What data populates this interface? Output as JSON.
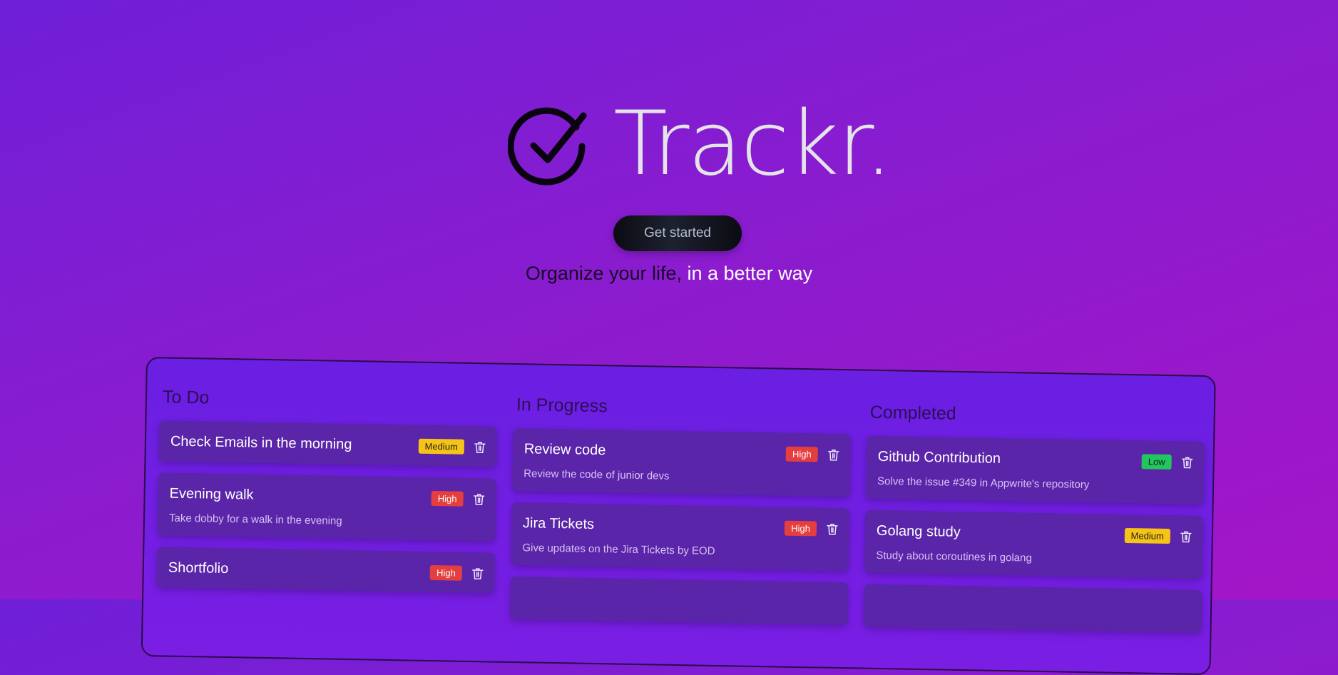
{
  "hero": {
    "brand_name": "Trackr.",
    "cta_label": "Get started",
    "tagline_dark": "Organize your life, ",
    "tagline_light": "in a better way"
  },
  "board": {
    "columns": [
      {
        "title": "To Do",
        "cards": [
          {
            "title": "Check Emails in the morning",
            "priority": "Medium",
            "description": ""
          },
          {
            "title": "Evening walk",
            "priority": "High",
            "description": "Take dobby for a walk in the evening"
          },
          {
            "title": "Shortfolio",
            "priority": "High",
            "description": ""
          }
        ]
      },
      {
        "title": "In Progress",
        "cards": [
          {
            "title": "Review code",
            "priority": "High",
            "description": "Review the code of junior devs"
          },
          {
            "title": "Jira Tickets",
            "priority": "High",
            "description": "Give updates on the Jira Tickets by EOD"
          }
        ]
      },
      {
        "title": "Completed",
        "cards": [
          {
            "title": "Github Contribution",
            "priority": "Low",
            "description": "Solve the issue #349 in Appwrite's repository"
          },
          {
            "title": "Golang study",
            "priority": "Medium",
            "description": "Study about coroutines in golang"
          }
        ]
      }
    ]
  },
  "colors": {
    "background_start": "#6f1fd8",
    "background_end": "#a415c8",
    "high": "#e53e3e",
    "medium": "#f6c416",
    "low": "#22c55e"
  }
}
